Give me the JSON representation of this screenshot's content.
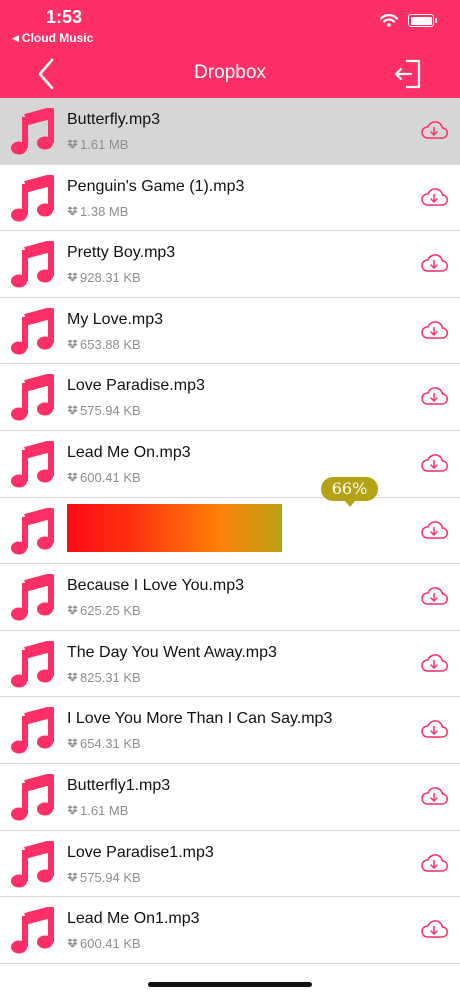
{
  "status_bar": {
    "time": "1:53",
    "back_app": "Cloud Music"
  },
  "nav": {
    "title": "Dropbox"
  },
  "colors": {
    "accent": "#fe2e66",
    "selected_row": "#d6d6d6",
    "progress_tip": "#b5a214"
  },
  "files": [
    {
      "name": "Butterfly.mp3",
      "size": "1.61 MB",
      "selected": true
    },
    {
      "name": "Penguin's Game (1).mp3",
      "size": "1.38 MB"
    },
    {
      "name": "Pretty Boy.mp3",
      "size": "928.31 KB"
    },
    {
      "name": "My Love.mp3",
      "size": "653.88 KB"
    },
    {
      "name": "Love Paradise.mp3",
      "size": "575.94 KB"
    },
    {
      "name": "Lead Me On.mp3",
      "size": "600.41 KB"
    },
    {
      "name": "",
      "size": "",
      "downloading": true,
      "progress_percent": 66,
      "progress_label": "66%"
    },
    {
      "name": "Because I Love You.mp3",
      "size": "625.25 KB"
    },
    {
      "name": "The Day You Went Away.mp3",
      "size": "825.31 KB"
    },
    {
      "name": "I Love You More Than I Can Say.mp3",
      "size": "654.31 KB"
    },
    {
      "name": "Butterfly1.mp3",
      "size": "1.61 MB"
    },
    {
      "name": "Love Paradise1.mp3",
      "size": "575.94 KB"
    },
    {
      "name": "Lead Me On1.mp3",
      "size": "600.41 KB"
    }
  ]
}
